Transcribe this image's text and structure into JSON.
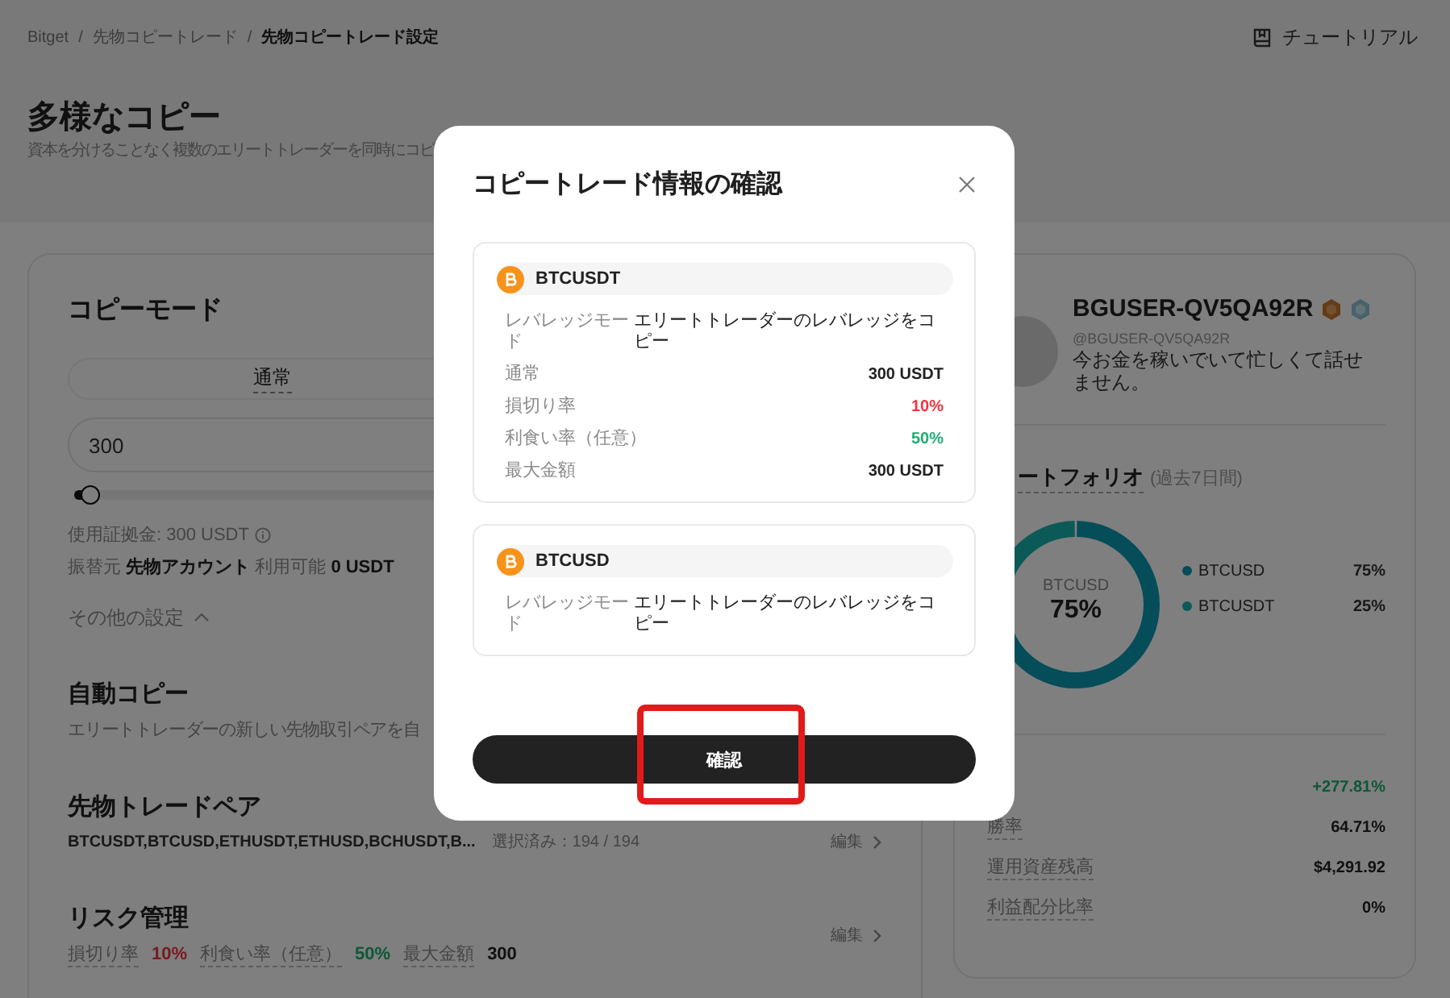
{
  "breadcrumb": [
    {
      "label": "Bitget",
      "current": false,
      "separator": "/"
    },
    {
      "label": "先物コピートレード",
      "current": false,
      "separator": "/"
    },
    {
      "label": "先物コピートレード設定",
      "current": true
    }
  ],
  "tutorial_link": "チュートリアル",
  "page_title": "多様なコピー",
  "page_subtitle": "資本を分けることなく複数のエリートトレーダーを同時にコピ",
  "copy_settings": {
    "title": "コピーモード",
    "tabs": [
      {
        "label": "通常",
        "selected": true
      }
    ],
    "amount_input": {
      "value": "300"
    },
    "amount_slider": {
      "level": 0.02
    },
    "margin_used": "使用証拠金: 300 USDT",
    "transfer_info": "振替元 **先物アカウント**  利用可能 **0 USDT**",
    "more_settings": {
      "label": "その他の設定",
      "expanded": true
    },
    "auto_copy": {
      "title": "自動コピー",
      "description": "エリートトレーダーの新しい先物取引ペアを自"
    },
    "trade_pairs": {
      "title": "先物トレードペア",
      "pairs": "BTCUSDT,BTCUSD,ETHUSDT,ETHUSD,BCHUSDT,B...",
      "selected_count": "選択済み：194 / 194",
      "edit_link": "編集"
    },
    "risk": {
      "title": "リスク管理",
      "items": [
        {
          "label": "損切り率",
          "value": "10%",
          "kind": "loss"
        },
        {
          "label": "利食い率（任意）",
          "value": "50%",
          "kind": "gain"
        },
        {
          "label": "最大金額",
          "value": "300",
          "kind": "plain"
        }
      ],
      "edit_link": "編集"
    }
  },
  "trader": {
    "name": "BGUSER-QV5QA92R",
    "handle": "@BGUSER-QV5QA92R",
    "bio": "今お金を稼いでいて忙しくて話せません。",
    "portfolio": {
      "title": "ートフォリオ",
      "period": "(過去7日間)",
      "center_label": "BTCUSD",
      "center_value": "75%",
      "chart_data": {
        "type": "donut",
        "categories": [
          "BTCUSD",
          "BTCUSDT"
        ],
        "values": [
          75,
          25
        ]
      },
      "legend_values": [
        "75%",
        "25%"
      ]
    },
    "stats": [
      {
        "value": "+277.81%",
        "kind": "gain"
      },
      {
        "label": "勝率",
        "value": "64.71%",
        "kind": "plain"
      },
      {
        "label": "運用資産残高",
        "value": "$4,291.92",
        "kind": "plain"
      },
      {
        "label": "利益配分比率",
        "value": "0%",
        "kind": "plain"
      }
    ]
  },
  "modal": {
    "title": "コピートレード情報の確認",
    "pairs": [
      {
        "symbol": "BTCUSDT",
        "rows": [
          {
            "kind": "wide",
            "label": "レバレッジモード",
            "value": "エリートトレーダーのレバレッジをコピー"
          },
          {
            "kind": "plain",
            "label": "通常",
            "value": "300 USDT"
          },
          {
            "kind": "loss",
            "label": "損切り率",
            "value": "10%"
          },
          {
            "kind": "gain",
            "label": "利食い率（任意）",
            "value": "50%"
          },
          {
            "kind": "plain",
            "label": "最大金額",
            "value": "300 USDT"
          }
        ]
      },
      {
        "symbol": "BTCUSD",
        "rows": [
          {
            "kind": "wide",
            "label": "レバレッジモード",
            "value": "エリートトレーダーのレバレッジをコピー"
          }
        ]
      }
    ],
    "confirm_button": {
      "label": "確認",
      "highlighted": true
    }
  }
}
